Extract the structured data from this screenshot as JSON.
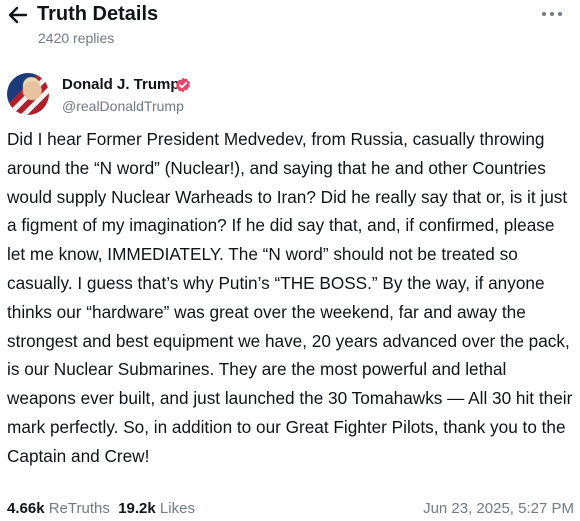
{
  "header": {
    "title": "Truth Details",
    "replies": "2420 replies"
  },
  "post": {
    "author_name": "Donald J. Trump",
    "handle": "@realDonaldTrump",
    "body": "Did I hear Former President Medvedev, from Russia, casually throwing around the “N word” (Nuclear!), and saying that he and other Countries would supply Nuclear Warheads to Iran? Did he really say that or, is it just a figment of my imagination? If he did say that, and, if confirmed, please let me know, IMMEDIATELY. The “N word” should not be treated so casually. I guess that’s why Putin’s “THE BOSS.” By the way, if anyone thinks our “hardware” was great over the weekend, far and away the strongest and best equipment we have, 20 years advanced over the pack, is our Nuclear Submarines. They are the most powerful and lethal weapons ever built, and just launched the 30 Tomahawks — All 30 hit their mark perfectly. So, in addition to our Great Fighter Pilots, thank you to the Captain and Crew!",
    "retruths_count": "4.66k",
    "retruths_label": "ReTruths",
    "likes_count": "19.2k",
    "likes_label": "Likes",
    "timestamp": "Jun 23, 2025, 5:27 PM"
  },
  "icons": {
    "back": "arrow-left-icon",
    "more": "more-horizontal-icon",
    "verified": "verified-badge-icon"
  },
  "colors": {
    "text": "#0f1419",
    "muted": "#6f7a86",
    "verified": "#e8476b"
  }
}
